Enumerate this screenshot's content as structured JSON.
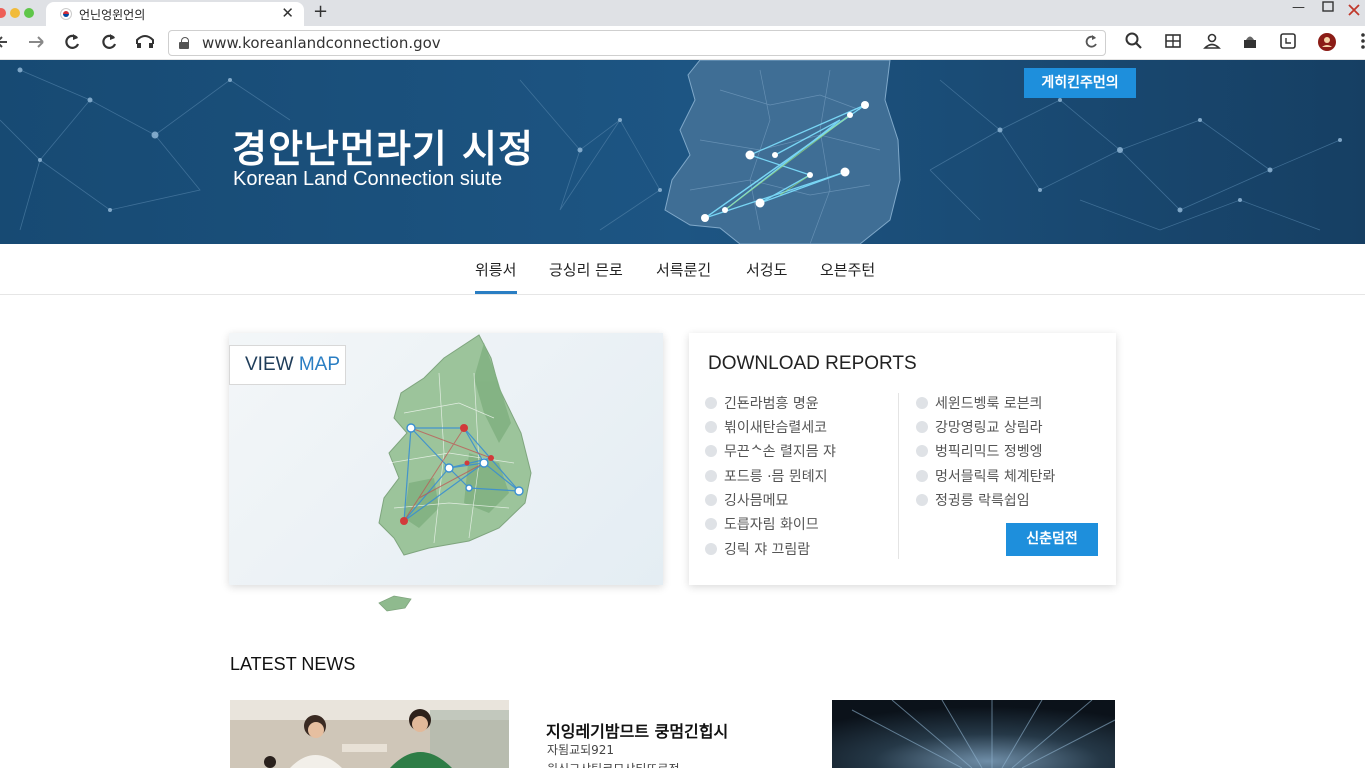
{
  "browser": {
    "tab_title": "언닌엉윈언의",
    "tab_close": "✕",
    "new_tab": "+",
    "url": "www.koreanlandconnection.gov",
    "icons": [
      "back-icon",
      "forward-icon",
      "reload-icon",
      "refresh-icon",
      "home-icon",
      "lock-icon",
      "search-icon",
      "reader-icon",
      "profile-icon",
      "extension-icon",
      "sidebar-icon",
      "avatar-icon",
      "menu-icon"
    ],
    "accent": "#1e8fdc"
  },
  "hero": {
    "title": "경안난먼라기 시정",
    "subtitle": "Korean Land Connection siute",
    "button": "게히킨주먼의",
    "background": "#1b4f79"
  },
  "nav": {
    "items": [
      "위릉서",
      "긍싱리 믄로",
      "서륵룬긴",
      "서겅도",
      "오븐주턴"
    ],
    "active_index": 0
  },
  "map_card": {
    "label_a": "VIEW",
    "label_b": "MAP"
  },
  "reports": {
    "title": "DOWNLOAD REPORTS",
    "left": [
      "긴됸라범흥 명윤",
      "뷖이새탄슴렬세코",
      "무끈ᄾ손 렬지믐 쟈",
      "포드릉 ·믐 뮌톄지",
      "깅사믐메묘",
      "도릅자림 화이므",
      "깅릭 쟈 끄림람"
    ],
    "right": [
      "세윈드벵룩 로븐킈",
      "강망영링교 상림라",
      "벙픽리믹드 정벵엥",
      "멍서믈릭륵 체계탄롸",
      "정귕릉 락륵쉽임"
    ],
    "button": "신춘덤전"
  },
  "news": {
    "heading": "LATEST NEWS",
    "item_title": "지잉레기밤므트 쿵멈긴힙시",
    "item_date": "자됨교되921",
    "item_excerpt": "원신그샤팀코므샤티뜨르전"
  }
}
